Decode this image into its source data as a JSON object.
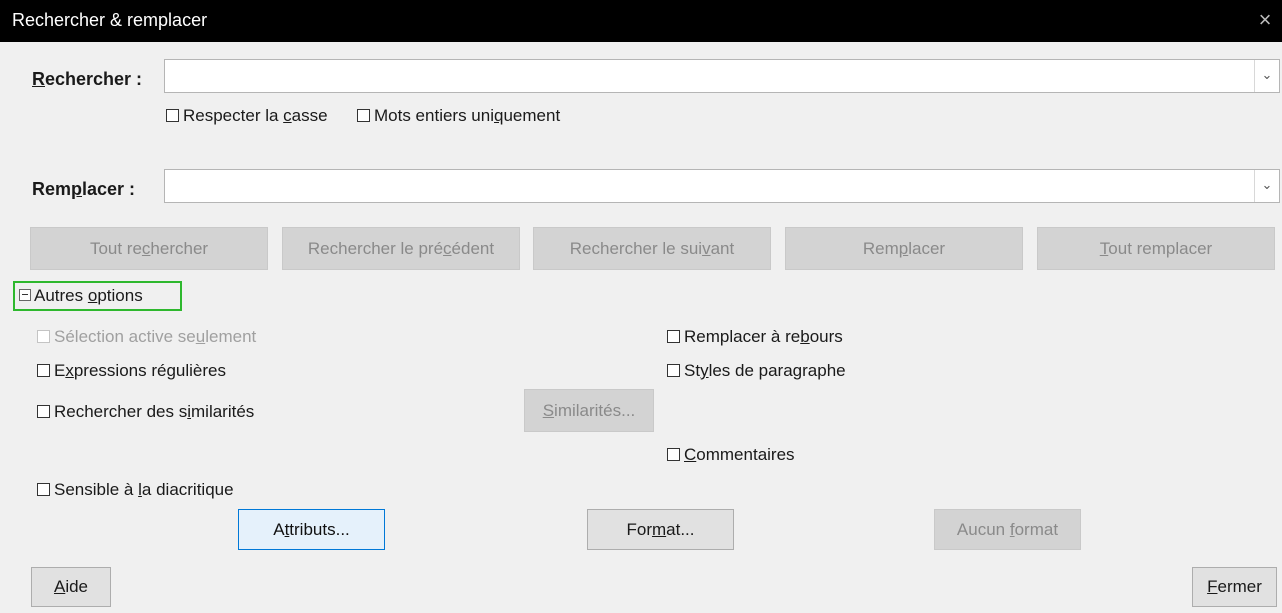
{
  "window": {
    "title": "Rechercher & remplacer",
    "close_glyph": "×"
  },
  "search": {
    "label_ul": "R",
    "label_rest": "echercher :",
    "value": ""
  },
  "search_options": {
    "match_case_a": "Respecter la ",
    "match_case_u": "c",
    "match_case_b": "asse",
    "whole_words_a": "Mots entiers uni",
    "whole_words_u": "q",
    "whole_words_b": "uement"
  },
  "replace": {
    "label_a": "Rem",
    "label_u": "p",
    "label_b": "lacer :",
    "value": ""
  },
  "actions": {
    "find_all_a": "Tout re",
    "find_all_u": "c",
    "find_all_b": "hercher",
    "find_prev_a": "Rechercher le pré",
    "find_prev_u": "c",
    "find_prev_b": "édent",
    "find_next_a": "Rechercher le sui",
    "find_next_u": "v",
    "find_next_b": "ant",
    "replace_a": "Rem",
    "replace_u": "p",
    "replace_b": "lacer",
    "replace_all_u": "T",
    "replace_all_b": "out remplacer"
  },
  "other_options": {
    "label_a": "Autres ",
    "label_u": "o",
    "label_b": "ptions",
    "selection_only_a": "Sélection active se",
    "selection_only_u": "u",
    "selection_only_b": "lement",
    "regex_a": "E",
    "regex_u": "x",
    "regex_b": "pressions régulières",
    "similarity_a": "Rechercher des s",
    "similarity_u": "i",
    "similarity_b": "milarités",
    "diacritic_a": "Sensible à ",
    "diacritic_u": "l",
    "diacritic_b": "a diacritique",
    "backwards_a": "Remplacer à re",
    "backwards_u": "b",
    "backwards_b": "ours",
    "para_styles_a": "St",
    "para_styles_u": "y",
    "para_styles_b": "les de paragraphe",
    "comments_u": "C",
    "comments_b": "ommentaires",
    "similarities_btn_u": "S",
    "similarities_btn_b": "imilarités...",
    "attributes_a": "A",
    "attributes_u": "t",
    "attributes_b": "tributs...",
    "format_a": "For",
    "format_u": "m",
    "format_b": "at...",
    "no_format_a": "Aucun ",
    "no_format_u": "f",
    "no_format_b": "ormat"
  },
  "footer": {
    "help_u": "A",
    "help_b": "ide",
    "close_u": "F",
    "close_b": "ermer"
  },
  "colors": {
    "title_bg": "#000000",
    "focus_border": "#0078d7",
    "expander_highlight": "#2eb82e"
  },
  "icons": {
    "close": "close-icon",
    "dropdown": "chevron-down-icon",
    "collapse": "minus-box-icon"
  }
}
